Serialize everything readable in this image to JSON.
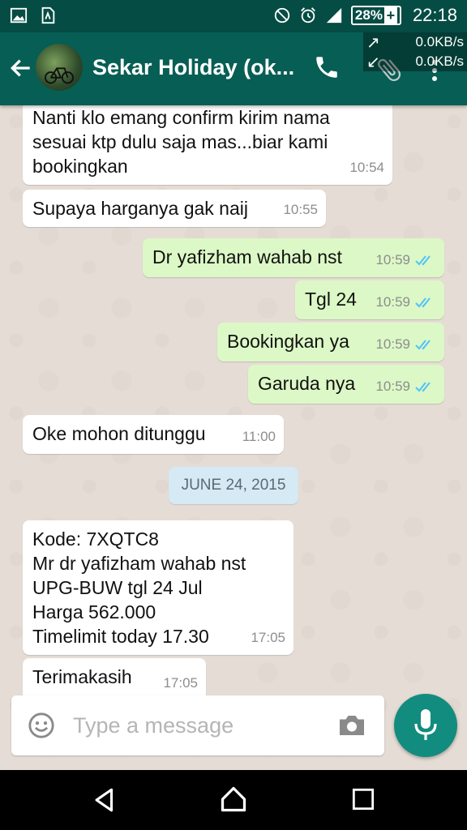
{
  "status_bar": {
    "battery": "28%",
    "time": "22:18",
    "icons": [
      "gallery-icon",
      "sim-icon",
      "do-not-disturb-icon",
      "alarm-icon",
      "signal-icon",
      "battery-icon"
    ]
  },
  "network_overlay": {
    "up": "0.0KB/s",
    "down": "0.0KB/s"
  },
  "header": {
    "contact_name": "Sekar Holiday (ok...",
    "icons": [
      "back-arrow-icon",
      "call-icon",
      "attach-icon",
      "more-vert-icon"
    ]
  },
  "messages": [
    {
      "dir": "in",
      "text": "Nanti klo emang confirm kirim nama\nsesuai ktp dulu saja mas...biar kami\nbookingkan",
      "time": "10:54"
    },
    {
      "dir": "in",
      "text": "Supaya harganya gak naij",
      "time": "10:55"
    },
    {
      "dir": "out",
      "text": "Dr yafizham wahab nst",
      "time": "10:59"
    },
    {
      "dir": "out",
      "text": "Tgl 24",
      "time": "10:59"
    },
    {
      "dir": "out",
      "text": "Bookingkan ya",
      "time": "10:59"
    },
    {
      "dir": "out",
      "text": "Garuda nya",
      "time": "10:59"
    },
    {
      "dir": "in",
      "text": "Oke mohon ditunggu",
      "time": "11:00"
    },
    {
      "dir": "in",
      "text": "Kode: 7XQTC8\nMr dr yafizham wahab nst\nUPG-BUW tgl 24 Jul\nHarga 562.000\nTimelimit today 17.30",
      "time": "17:05"
    },
    {
      "dir": "in",
      "text": "Terimakasih",
      "time": "17:05"
    }
  ],
  "date_divider": "JUNE 24, 2015",
  "composer": {
    "placeholder": "Type a message",
    "icons": [
      "emoji-icon",
      "camera-icon",
      "mic-icon"
    ]
  },
  "colors": {
    "status_bar": "#054d44",
    "app_bar": "#075e54",
    "outgoing_bubble": "#dcf8c6",
    "incoming_bubble": "#ffffff",
    "chat_background": "#e5ddd5",
    "mic_button": "#128c7e",
    "read_ticks": "#4fc3f7"
  }
}
